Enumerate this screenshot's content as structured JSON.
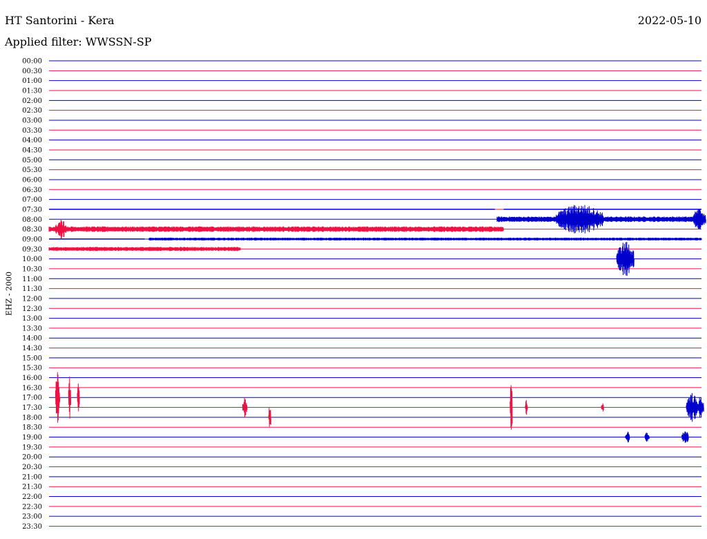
{
  "header": {
    "station": "HT Santorini - Kera",
    "date": "2022-05-10",
    "filter_label": "Applied filter: WWSSN-SP"
  },
  "channel_label": "EHZ - 2000",
  "colors": {
    "even_row": "#0000cc",
    "odd_row": "#ee1144"
  },
  "chart_data": {
    "type": "line",
    "title": "HT Santorini - Kera",
    "ylabel": "EHZ - 2000",
    "y_ticks": [
      "00:00",
      "00:30",
      "01:00",
      "01:30",
      "02:00",
      "02:30",
      "03:00",
      "03:30",
      "04:00",
      "04:30",
      "05:00",
      "05:30",
      "06:00",
      "06:30",
      "07:00",
      "07:30",
      "08:00",
      "08:30",
      "09:00",
      "09:30",
      "10:00",
      "10:30",
      "11:00",
      "11:30",
      "12:00",
      "12:30",
      "13:00",
      "13:30",
      "14:00",
      "14:30",
      "15:00",
      "15:30",
      "16:00",
      "16:30",
      "17:00",
      "17:30",
      "18:00",
      "18:30",
      "19:00",
      "19:30",
      "20:00",
      "20:30",
      "21:00",
      "21:30",
      "22:00",
      "22:30",
      "23:00",
      "23:30"
    ],
    "x_range": [
      0,
      30
    ],
    "x_unit": "minutes",
    "segments": [
      {
        "row": 15,
        "start": 0.0,
        "end": 20.5,
        "amp": 0,
        "color": "blue"
      },
      {
        "row": 15,
        "start": 20.9,
        "end": 30.0,
        "amp": 0,
        "color": "blue"
      },
      {
        "row": 16,
        "start": 20.6,
        "end": 30.0,
        "amp": 4,
        "color": "blue"
      },
      {
        "row": 17,
        "start": 0.0,
        "end": 20.9,
        "amp": 4,
        "color": "red"
      },
      {
        "row": 18,
        "start": 0.0,
        "end": 4.4,
        "amp": 0,
        "color": "blue"
      },
      {
        "row": 18,
        "start": 4.6,
        "end": 30.0,
        "amp": 2,
        "color": "blue"
      },
      {
        "row": 19,
        "start": 0.0,
        "end": 8.8,
        "amp": 3,
        "color": "red"
      }
    ],
    "events": [
      {
        "row": 16,
        "t": 23.3,
        "amp": 22,
        "width": 2.2,
        "color": "blue"
      },
      {
        "row": 16,
        "t": 29.6,
        "amp": 16,
        "width": 0.6,
        "color": "blue"
      },
      {
        "row": 17,
        "t": 0.3,
        "amp": 14,
        "width": 0.5,
        "color": "red"
      },
      {
        "row": 20,
        "t": 26.1,
        "amp": 26,
        "width": 0.8,
        "color": "blue"
      },
      {
        "row": 34,
        "t": 0.3,
        "amp": 38,
        "width": 0.2,
        "color": "red"
      },
      {
        "row": 34,
        "t": 0.9,
        "amp": 34,
        "width": 0.1,
        "color": "red"
      },
      {
        "row": 34,
        "t": 1.3,
        "amp": 24,
        "width": 0.1,
        "color": "red"
      },
      {
        "row": 35,
        "t": 8.9,
        "amp": 16,
        "width": 0.2,
        "color": "red"
      },
      {
        "row": 36,
        "t": 10.1,
        "amp": 20,
        "width": 0.1,
        "color": "red"
      },
      {
        "row": 35,
        "t": 21.2,
        "amp": 40,
        "width": 0.1,
        "color": "red"
      },
      {
        "row": 35,
        "t": 21.9,
        "amp": 12,
        "width": 0.1,
        "color": "red"
      },
      {
        "row": 35,
        "t": 25.4,
        "amp": 8,
        "width": 0.1,
        "color": "red"
      },
      {
        "row": 35,
        "t": 29.3,
        "amp": 22,
        "width": 0.5,
        "color": "blue"
      },
      {
        "row": 35,
        "t": 29.8,
        "amp": 16,
        "width": 0.3,
        "color": "blue"
      },
      {
        "row": 38,
        "t": 26.5,
        "amp": 8,
        "width": 0.2,
        "color": "blue"
      },
      {
        "row": 38,
        "t": 27.4,
        "amp": 8,
        "width": 0.2,
        "color": "blue"
      },
      {
        "row": 38,
        "t": 29.1,
        "amp": 10,
        "width": 0.3,
        "color": "blue"
      }
    ]
  }
}
